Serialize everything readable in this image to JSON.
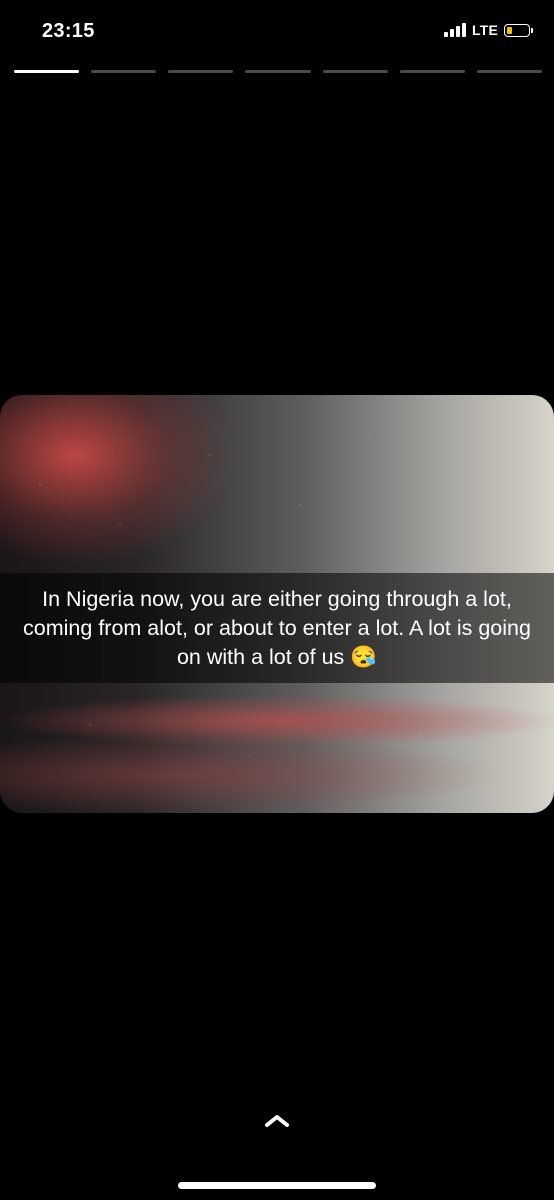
{
  "status_bar": {
    "time": "23:15",
    "network": "LTE",
    "battery_level": 0.25,
    "battery_color": "#f2c200",
    "signal_bars": 4
  },
  "story": {
    "segments_total": 7,
    "active_segment": 1,
    "caption": "In Nigeria now, you are either going through a lot, coming from alot, or about to enter a lot. A lot is going on with a lot of us 😪"
  },
  "icons": {
    "swipe_up": "chevron-up-icon"
  }
}
